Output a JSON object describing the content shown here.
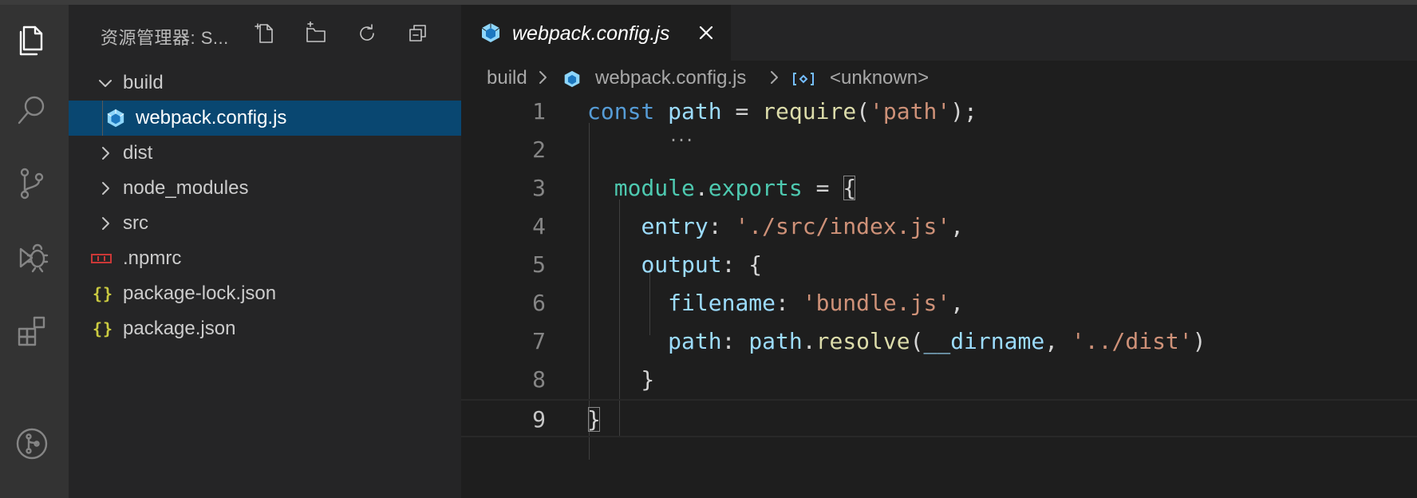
{
  "explorer": {
    "title": "资源管理器: S...",
    "actions": [
      "new-file",
      "new-folder",
      "refresh",
      "collapse-all"
    ],
    "items": [
      {
        "label": "build",
        "type": "folder",
        "expanded": true
      },
      {
        "label": "webpack.config.js",
        "type": "webpack",
        "selected": true
      },
      {
        "label": "dist",
        "type": "folder",
        "expanded": false
      },
      {
        "label": "node_modules",
        "type": "folder",
        "expanded": false
      },
      {
        "label": "src",
        "type": "folder",
        "expanded": false
      },
      {
        "label": ".npmrc",
        "type": "npm"
      },
      {
        "label": "package-lock.json",
        "type": "json"
      },
      {
        "label": "package.json",
        "type": "json"
      }
    ]
  },
  "activity_bar": {
    "icons": [
      "files-icon",
      "search-icon",
      "source-control-icon",
      "debug-icon",
      "extensions-icon",
      "git-graph-icon"
    ]
  },
  "tab": {
    "label": "webpack.config.js"
  },
  "breadcrumb": {
    "folder": "build",
    "file": "webpack.config.js",
    "symbol": "<unknown>"
  },
  "json_glyph": "{}",
  "code": {
    "line_numbers": [
      "1",
      "2",
      "3",
      "4",
      "5",
      "6",
      "7",
      "8",
      "9"
    ],
    "active_line": 9
  },
  "colors": {
    "selection": "#094771",
    "keyword": "#569cd6",
    "string": "#ce9178",
    "function": "#dcdcaa",
    "variable": "#9cdcfe",
    "module": "#4ec9b0",
    "json_icon": "#cbcb41",
    "npm_icon": "#cb3837",
    "webpack_icon": "#8ed6fb"
  }
}
